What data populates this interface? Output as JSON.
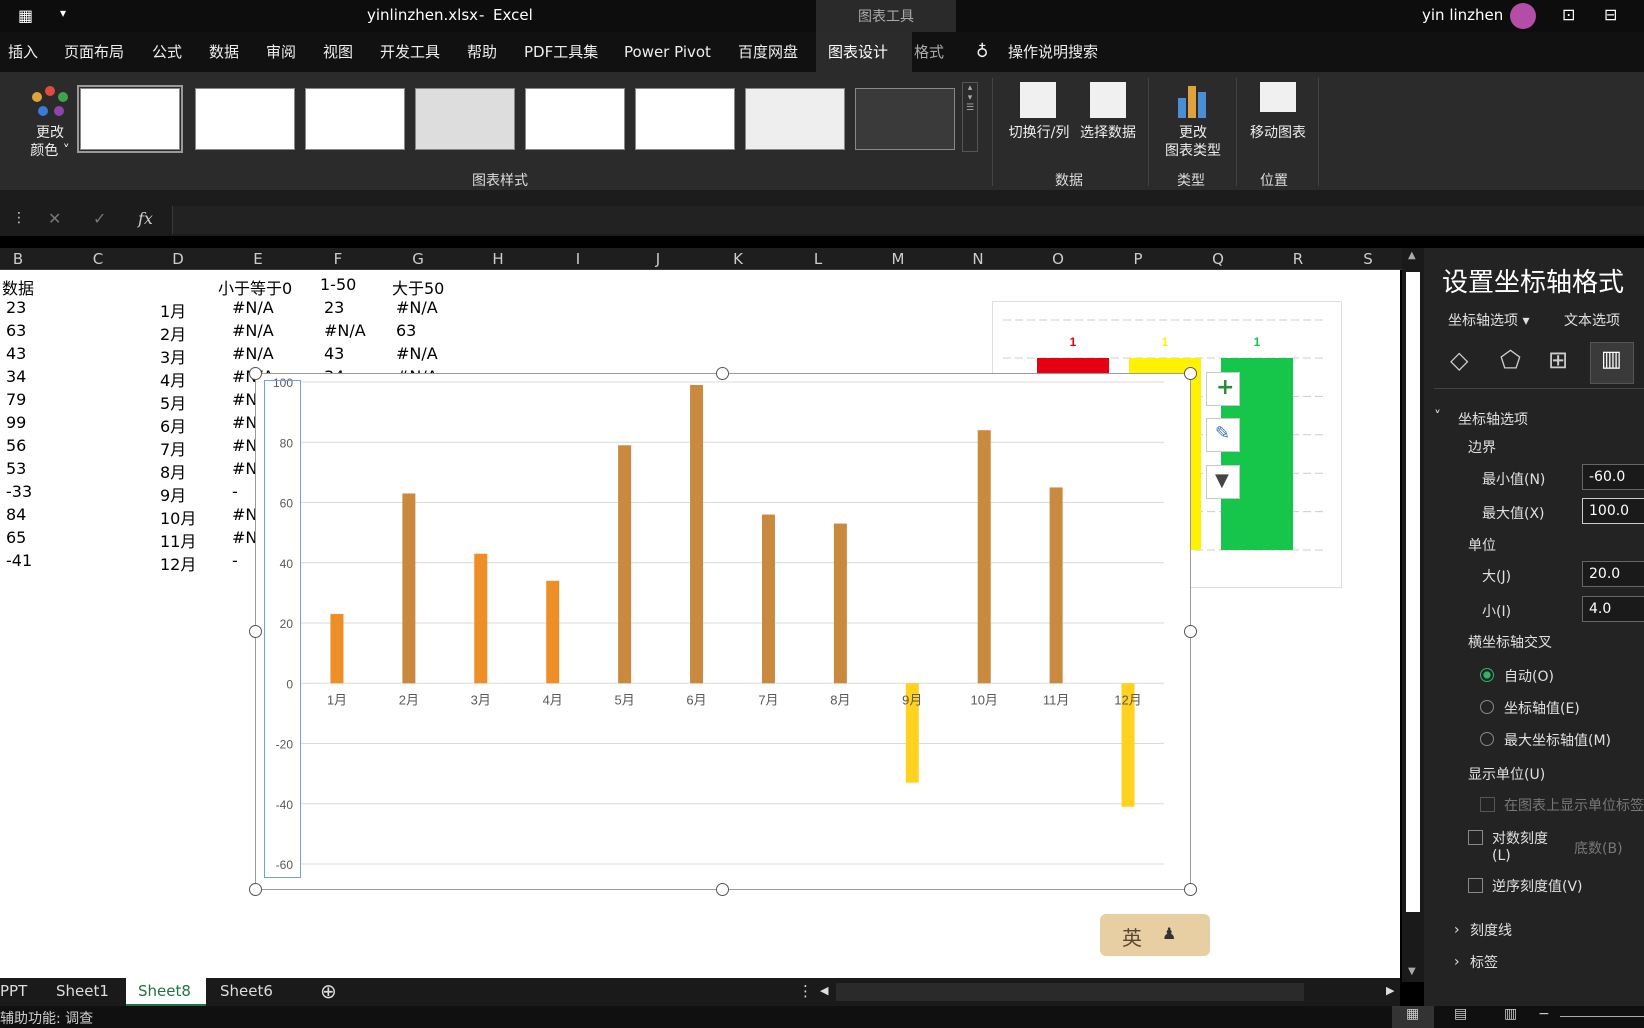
{
  "title": {
    "qat_icon": "save-grid-icon",
    "filename": "yinlinzhen.xlsx",
    "sep": "-",
    "app": "Excel",
    "chart_tools": "图表工具",
    "user": "yin linzhen"
  },
  "ribbon_tabs": [
    "插入",
    "页面布局",
    "公式",
    "数据",
    "审阅",
    "视图",
    "开发工具",
    "帮助",
    "PDF工具集",
    "Power Pivot",
    "百度网盘",
    "图表设计",
    "格式"
  ],
  "search_label": "操作说明搜索",
  "ribbon": {
    "change_colors": [
      "更改",
      "颜色"
    ],
    "chart_styles": "图表样式",
    "switch_row_col": "切换行/列",
    "select_data": "选择数据",
    "data_group": "数据",
    "change_type": [
      "更改",
      "图表类型"
    ],
    "type_group": "类型",
    "move_chart": "移动图表",
    "location_group": "位置"
  },
  "formula": {
    "cancel": "✕",
    "enter": "✓",
    "fx": "fx"
  },
  "columns": [
    "B",
    "C",
    "D",
    "E",
    "F",
    "G",
    "H",
    "I",
    "J",
    "K",
    "L",
    "M",
    "N",
    "O",
    "P",
    "Q",
    "R",
    "S"
  ],
  "headers": {
    "b": "数据",
    "e": "小于等于0",
    "f": "1-50",
    "g": "大于50"
  },
  "rows": [
    {
      "b": "23",
      "d": "1月",
      "e": "#N/A",
      "f": "23",
      "g": "#N/A"
    },
    {
      "b": "63",
      "d": "2月",
      "e": "#N/A",
      "f": "#N/A",
      "g": "63"
    },
    {
      "b": "43",
      "d": "3月",
      "e": "#N/A",
      "f": "43",
      "g": "#N/A"
    },
    {
      "b": "34",
      "d": "4月",
      "e": "#N/A",
      "f": "34",
      "g": "#N/A"
    },
    {
      "b": "79",
      "d": "5月",
      "e": "#N"
    },
    {
      "b": "99",
      "d": "6月",
      "e": "#N"
    },
    {
      "b": "56",
      "d": "7月",
      "e": "#N"
    },
    {
      "b": "53",
      "d": "8月",
      "e": "#N"
    },
    {
      "b": "-33",
      "d": "9月",
      "e": "-"
    },
    {
      "b": "84",
      "d": "10月",
      "e": "#N"
    },
    {
      "b": "65",
      "d": "11月",
      "e": "#N"
    },
    {
      "b": "-41",
      "d": "12月",
      "e": "-"
    }
  ],
  "colors": {
    "orange": "#ED8E26",
    "brown": "#C9893F",
    "yellow": "#FFD21F",
    "red": "#E60012",
    "yellow2": "#FFF200",
    "green": "#16C64B"
  },
  "chart_data": [
    {
      "type": "bar",
      "categories": [
        "1月",
        "2月",
        "3月",
        "4月",
        "5月",
        "6月",
        "7月",
        "8月",
        "9月",
        "10月",
        "11月",
        "12月"
      ],
      "values": [
        23,
        63,
        43,
        34,
        79,
        99,
        56,
        53,
        -33,
        84,
        65,
        -41
      ],
      "bar_colors": [
        "#ED8E26",
        "#C9893F",
        "#ED8E26",
        "#ED8E26",
        "#C9893F",
        "#C9893F",
        "#C9893F",
        "#C9893F",
        "#FFD21F",
        "#C9893F",
        "#C9893F",
        "#FFD21F"
      ],
      "ylim": [
        -60,
        100
      ],
      "yticks": [
        100,
        80,
        60,
        40,
        20,
        0,
        -20,
        -40,
        -60
      ],
      "grid": true
    },
    {
      "type": "bar",
      "categories": [
        "",
        "",
        ""
      ],
      "values": [
        1,
        1,
        1
      ],
      "data_labels": [
        "1",
        "1",
        "1"
      ],
      "bar_colors": [
        "#E60012",
        "#FFF200",
        "#16C64B"
      ]
    }
  ],
  "sheet_tabs": [
    "PPT",
    "Sheet1",
    "Sheet8",
    "Sheet6"
  ],
  "status": "辅助功能: 调查",
  "ime": "英",
  "panel": {
    "title": "设置坐标轴格式",
    "options": "坐标轴选项",
    "text_options": "文本选项",
    "section": "坐标轴选项",
    "bounds": "边界",
    "min_label": "最小值(N)",
    "min_value": "-60.0",
    "max_label": "最大值(X)",
    "max_value": "100.0",
    "units": "单位",
    "major_label": "大(J)",
    "major_value": "20.0",
    "minor_label": "小(I)",
    "minor_value": "4.0",
    "cross": "横坐标轴交叉",
    "auto": "自动(O)",
    "axis_value": "坐标轴值(E)",
    "max_axis": "最大坐标轴值(M)",
    "display_units": "显示单位(U)",
    "show_units": "在图表上显示单位标签",
    "log_scale": [
      "对数刻度",
      "(L)"
    ],
    "log_base": "底数(B)",
    "reverse": "逆序刻度值(V)",
    "ticks": "刻度线",
    "labels": "标签"
  }
}
